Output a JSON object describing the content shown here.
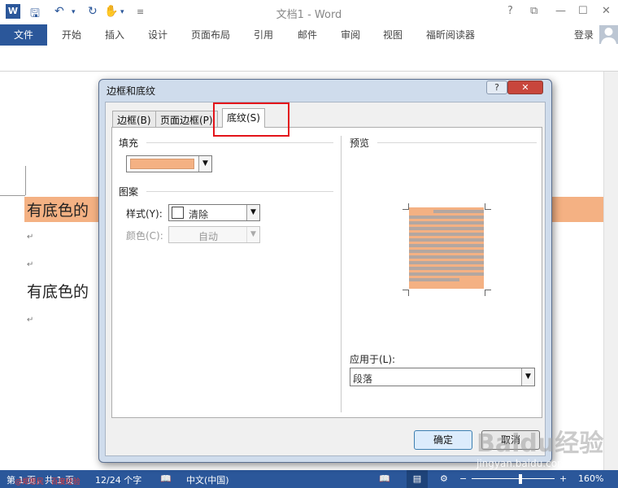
{
  "window": {
    "doc_title": "文档1 - Word",
    "help": "?",
    "restore": "⧉",
    "minimize": "—",
    "maximize": "☐",
    "close": "✕"
  },
  "qat": {
    "word_icon": "W",
    "save_icon": "save-icon",
    "undo_icon": "undo-icon",
    "redo_icon": "redo-icon",
    "touch_icon": "touch-icon",
    "customize_icon": "customize-icon"
  },
  "ribbon": {
    "file": "文件",
    "tabs": [
      "开始",
      "插入",
      "设计",
      "页面布局",
      "引用",
      "邮件",
      "审阅",
      "视图",
      "福昕阅读器"
    ],
    "login": "登录"
  },
  "document": {
    "line1": "有底色的",
    "line2": "有底色的",
    "para_mark": "↵"
  },
  "dialog": {
    "title": "边框和底纹",
    "help": "?",
    "close": "✕",
    "tabs": [
      "边框(B)",
      "页面边框(P)",
      "底纹(S)"
    ],
    "active_tab": "底纹(S)",
    "fill_label": "填充",
    "fill_color": "#f4b183",
    "pattern_label": "图案",
    "style_label": "样式(Y):",
    "style_value": "清除",
    "color_label": "颜色(C):",
    "color_value": "自动",
    "preview_label": "预览",
    "apply_label": "应用于(L):",
    "apply_value": "段落",
    "ok": "确定",
    "cancel": "取消"
  },
  "status": {
    "page": "第 1 页，共 1 页",
    "words": "12/24 个字",
    "language": "中文(中国)",
    "zoom": "160%"
  },
  "watermark": {
    "brand": "Baidu经验",
    "url": "jingyan.baidu.com",
    "red": "@郑恩民 · 百度经验"
  },
  "colors": {
    "accent": "#2b579a",
    "shading": "#f4b183",
    "highlight": "#e3141a"
  }
}
